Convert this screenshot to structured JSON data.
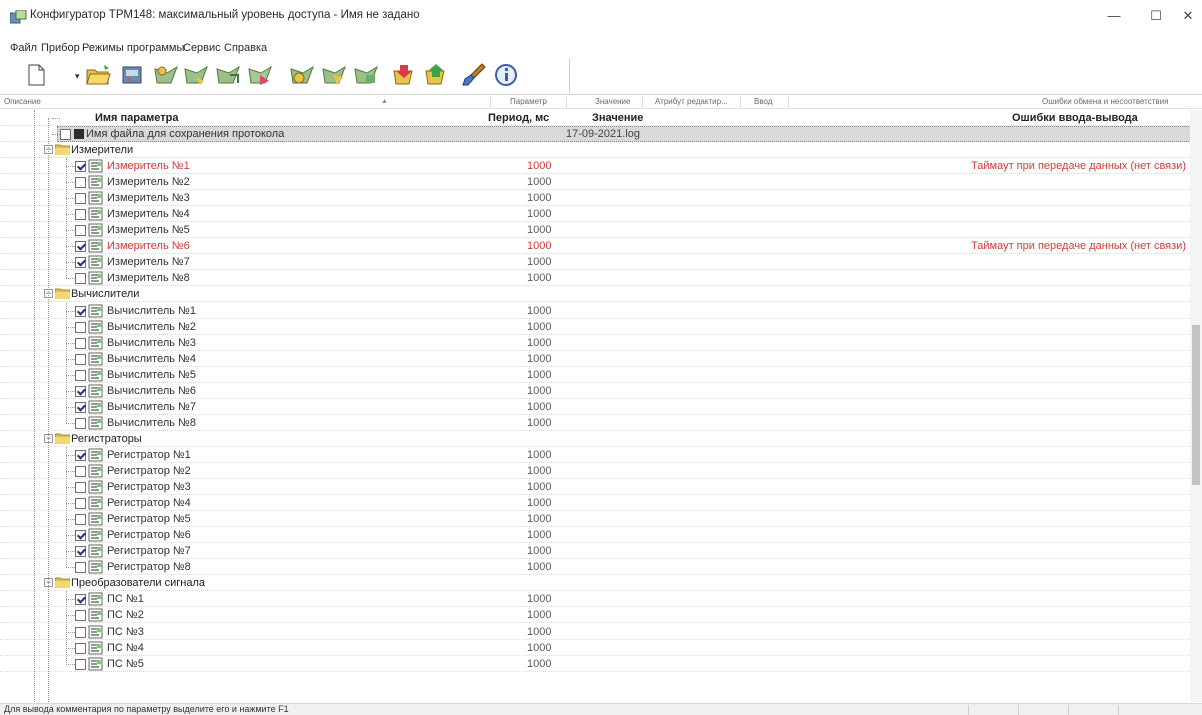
{
  "window": {
    "title": "Конфигуратор ТРМ148: максимальный уровень доступа - Имя не задано",
    "minimize": "—",
    "maximize": "☐",
    "close": "✕"
  },
  "menu": [
    "Файл",
    "Прибор",
    "Режимы программы",
    "Сервис",
    "Справка"
  ],
  "toolbar": {
    "buttons": [
      {
        "name": "new-file-icon"
      },
      {
        "name": "open-folder-icon"
      },
      {
        "name": "device-icon"
      },
      {
        "name": "read-all-icon"
      },
      {
        "name": "read-icon"
      },
      {
        "name": "write-icon"
      },
      {
        "name": "compare-icon"
      },
      {
        "name": "read-changed-icon"
      },
      {
        "name": "read-selected-icon"
      },
      {
        "name": "write-selected-icon"
      },
      {
        "name": "load-red-icon"
      },
      {
        "name": "save-green-icon"
      },
      {
        "name": "brush-icon"
      },
      {
        "name": "info-icon"
      }
    ]
  },
  "columns": {
    "description": "Описание",
    "parameter": "Параметр",
    "value": "Значение",
    "edit_attr": "Атрибут редактир...",
    "input": "Ввод",
    "errors": "Ошибки обмена и несоответствия"
  },
  "header_row": {
    "name": "Имя параметра",
    "period": "Период, мс",
    "value": "Значение",
    "errors": "Ошибки ввода-вывода"
  },
  "file_row": {
    "name": "Имя файла для сохранения протокола",
    "value": "17-09-2021.log"
  },
  "groups": [
    {
      "label": "Измерители",
      "items": [
        {
          "label": "Измеритель №1",
          "checked": true,
          "period": "1000",
          "error": "Таймаут при передаче данных (нет связи)",
          "red": true
        },
        {
          "label": "Измеритель №2",
          "checked": false,
          "period": "1000",
          "error": "",
          "red": false
        },
        {
          "label": "Измеритель №3",
          "checked": false,
          "period": "1000",
          "error": "",
          "red": false
        },
        {
          "label": "Измеритель №4",
          "checked": false,
          "period": "1000",
          "error": "",
          "red": false
        },
        {
          "label": "Измеритель №5",
          "checked": false,
          "period": "1000",
          "error": "",
          "red": false
        },
        {
          "label": "Измеритель №6",
          "checked": true,
          "period": "1000",
          "error": "Таймаут при передаче данных (нет связи)",
          "red": true
        },
        {
          "label": "Измеритель №7",
          "checked": true,
          "period": "1000",
          "error": "",
          "red": false
        },
        {
          "label": "Измеритель №8",
          "checked": false,
          "period": "1000",
          "error": "",
          "red": false
        }
      ]
    },
    {
      "label": "Вычислители",
      "items": [
        {
          "label": "Вычислитель №1",
          "checked": true,
          "period": "1000",
          "error": "",
          "red": false
        },
        {
          "label": "Вычислитель №2",
          "checked": false,
          "period": "1000",
          "error": "",
          "red": false
        },
        {
          "label": "Вычислитель №3",
          "checked": false,
          "period": "1000",
          "error": "",
          "red": false
        },
        {
          "label": "Вычислитель №4",
          "checked": false,
          "period": "1000",
          "error": "",
          "red": false
        },
        {
          "label": "Вычислитель №5",
          "checked": false,
          "period": "1000",
          "error": "",
          "red": false
        },
        {
          "label": "Вычислитель №6",
          "checked": true,
          "period": "1000",
          "error": "",
          "red": false
        },
        {
          "label": "Вычислитель №7",
          "checked": true,
          "period": "1000",
          "error": "",
          "red": false
        },
        {
          "label": "Вычислитель №8",
          "checked": false,
          "period": "1000",
          "error": "",
          "red": false
        }
      ]
    },
    {
      "label": "Регистраторы",
      "items": [
        {
          "label": "Регистратор №1",
          "checked": true,
          "period": "1000",
          "error": "",
          "red": false
        },
        {
          "label": "Регистратор №2",
          "checked": false,
          "period": "1000",
          "error": "",
          "red": false
        },
        {
          "label": "Регистратор №3",
          "checked": false,
          "period": "1000",
          "error": "",
          "red": false
        },
        {
          "label": "Регистратор №4",
          "checked": false,
          "period": "1000",
          "error": "",
          "red": false
        },
        {
          "label": "Регистратор №5",
          "checked": false,
          "period": "1000",
          "error": "",
          "red": false
        },
        {
          "label": "Регистратор №6",
          "checked": true,
          "period": "1000",
          "error": "",
          "red": false
        },
        {
          "label": "Регистратор №7",
          "checked": true,
          "period": "1000",
          "error": "",
          "red": false
        },
        {
          "label": "Регистратор №8",
          "checked": false,
          "period": "1000",
          "error": "",
          "red": false
        }
      ]
    },
    {
      "label": "Преобразователи сигнала",
      "items": [
        {
          "label": "ПС №1",
          "checked": true,
          "period": "1000",
          "error": "",
          "red": false
        },
        {
          "label": "ПС №2",
          "checked": false,
          "period": "1000",
          "error": "",
          "red": false
        },
        {
          "label": "ПС №3",
          "checked": false,
          "period": "1000",
          "error": "",
          "red": false
        },
        {
          "label": "ПС №4",
          "checked": false,
          "period": "1000",
          "error": "",
          "red": false
        },
        {
          "label": "ПС №5",
          "checked": false,
          "period": "1000",
          "error": "",
          "red": false
        }
      ]
    }
  ],
  "status": {
    "text": "Для вывода комментария по параметру выделите его и нажмите F1"
  },
  "colors": {
    "error_red": "#d53a3a",
    "selection_gray": "#d9d9d9"
  }
}
